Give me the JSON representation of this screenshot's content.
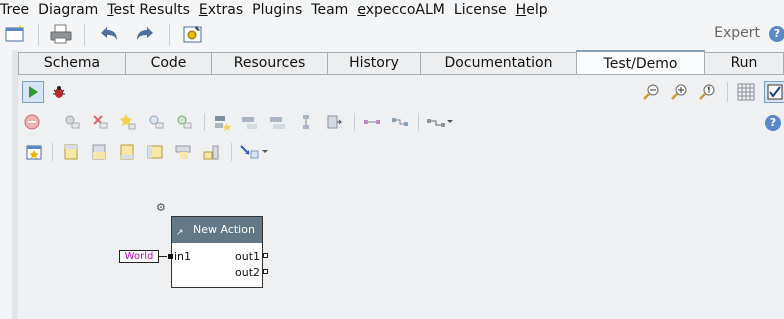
{
  "menu": [
    "Tree",
    "Diagram",
    "Test Results",
    "Extras",
    "Plugins",
    "Team",
    "expeccoALM",
    "License",
    "Help"
  ],
  "toolbar": {
    "mode_label": "Expert",
    "help_glyph": "?"
  },
  "tabs": [
    "Schema",
    "Code",
    "Resources",
    "History",
    "Documentation",
    "Test/Demo",
    "Run"
  ],
  "active_tab": "Test/Demo",
  "diagram": {
    "action_title": "New Action",
    "input_pin": "in1",
    "output_pins": [
      "out1",
      "out2"
    ],
    "input_value": "World"
  },
  "colors": {
    "header": "#647785",
    "value_text": "#c000c0",
    "accent": "#5a87c6"
  }
}
